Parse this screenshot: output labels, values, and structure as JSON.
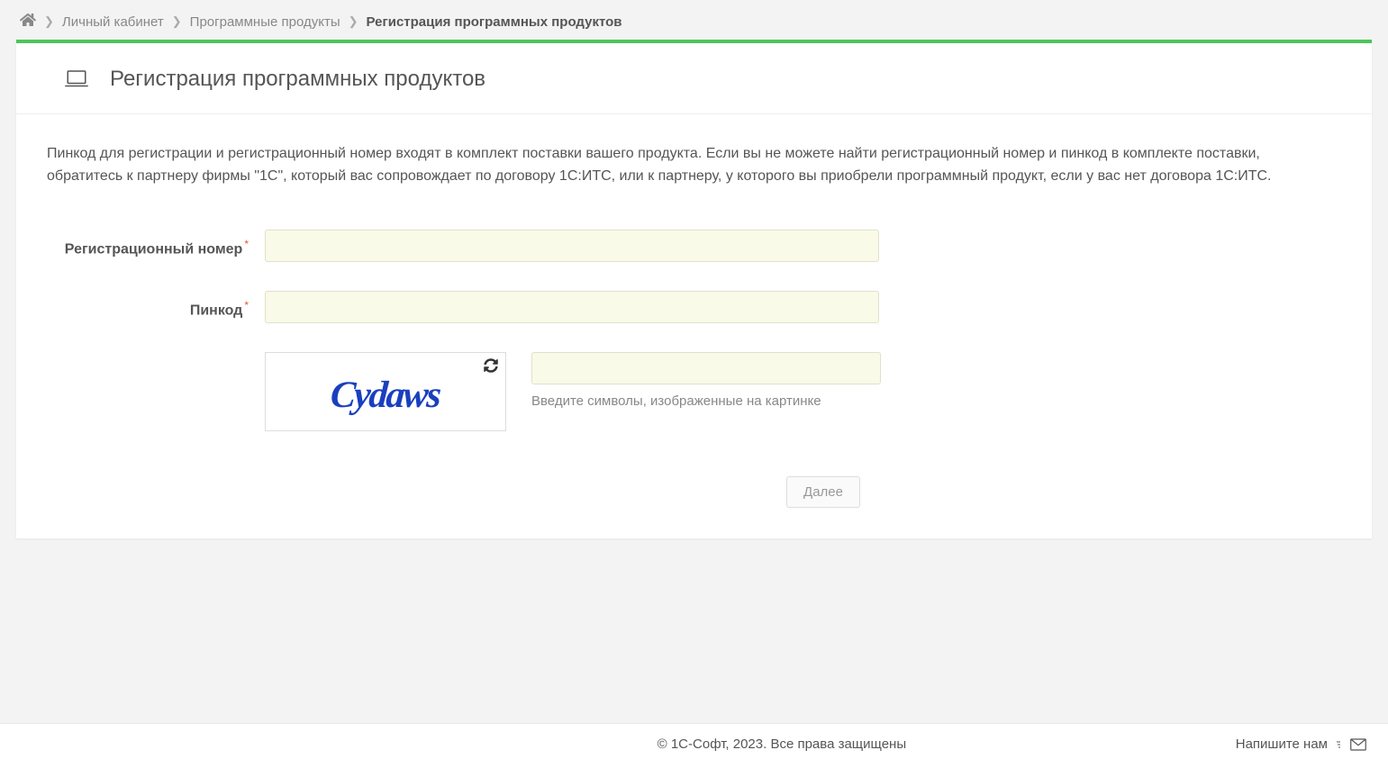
{
  "breadcrumb": {
    "home_aria": "Главная",
    "items": [
      {
        "label": "Личный кабинет"
      },
      {
        "label": "Программные продукты"
      }
    ],
    "current": "Регистрация программных продуктов"
  },
  "page": {
    "title": "Регистрация программных продуктов",
    "intro": "Пинкод для регистрации и регистрационный номер входят в комплект поставки вашего продукта. Если вы не можете найти регистрационный номер и пинкод в комплекте поставки, обратитесь к партнеру фирмы \"1С\", который вас сопровождает по договору 1С:ИТС, или к партнеру, у которого вы приобрели программный продукт, если у вас нет договора 1С:ИТС."
  },
  "form": {
    "reg_label": "Регистрационный номер",
    "reg_value": "",
    "pin_label": "Пинкод",
    "pin_value": "",
    "captcha_text": "Cydaws",
    "captcha_value": "",
    "captcha_hint": "Введите символы, изображенные на картинке",
    "submit_label": "Далее"
  },
  "footer": {
    "copyright": "© 1С-Софт, 2023. Все права защищены",
    "contact": "Напишите нам"
  }
}
